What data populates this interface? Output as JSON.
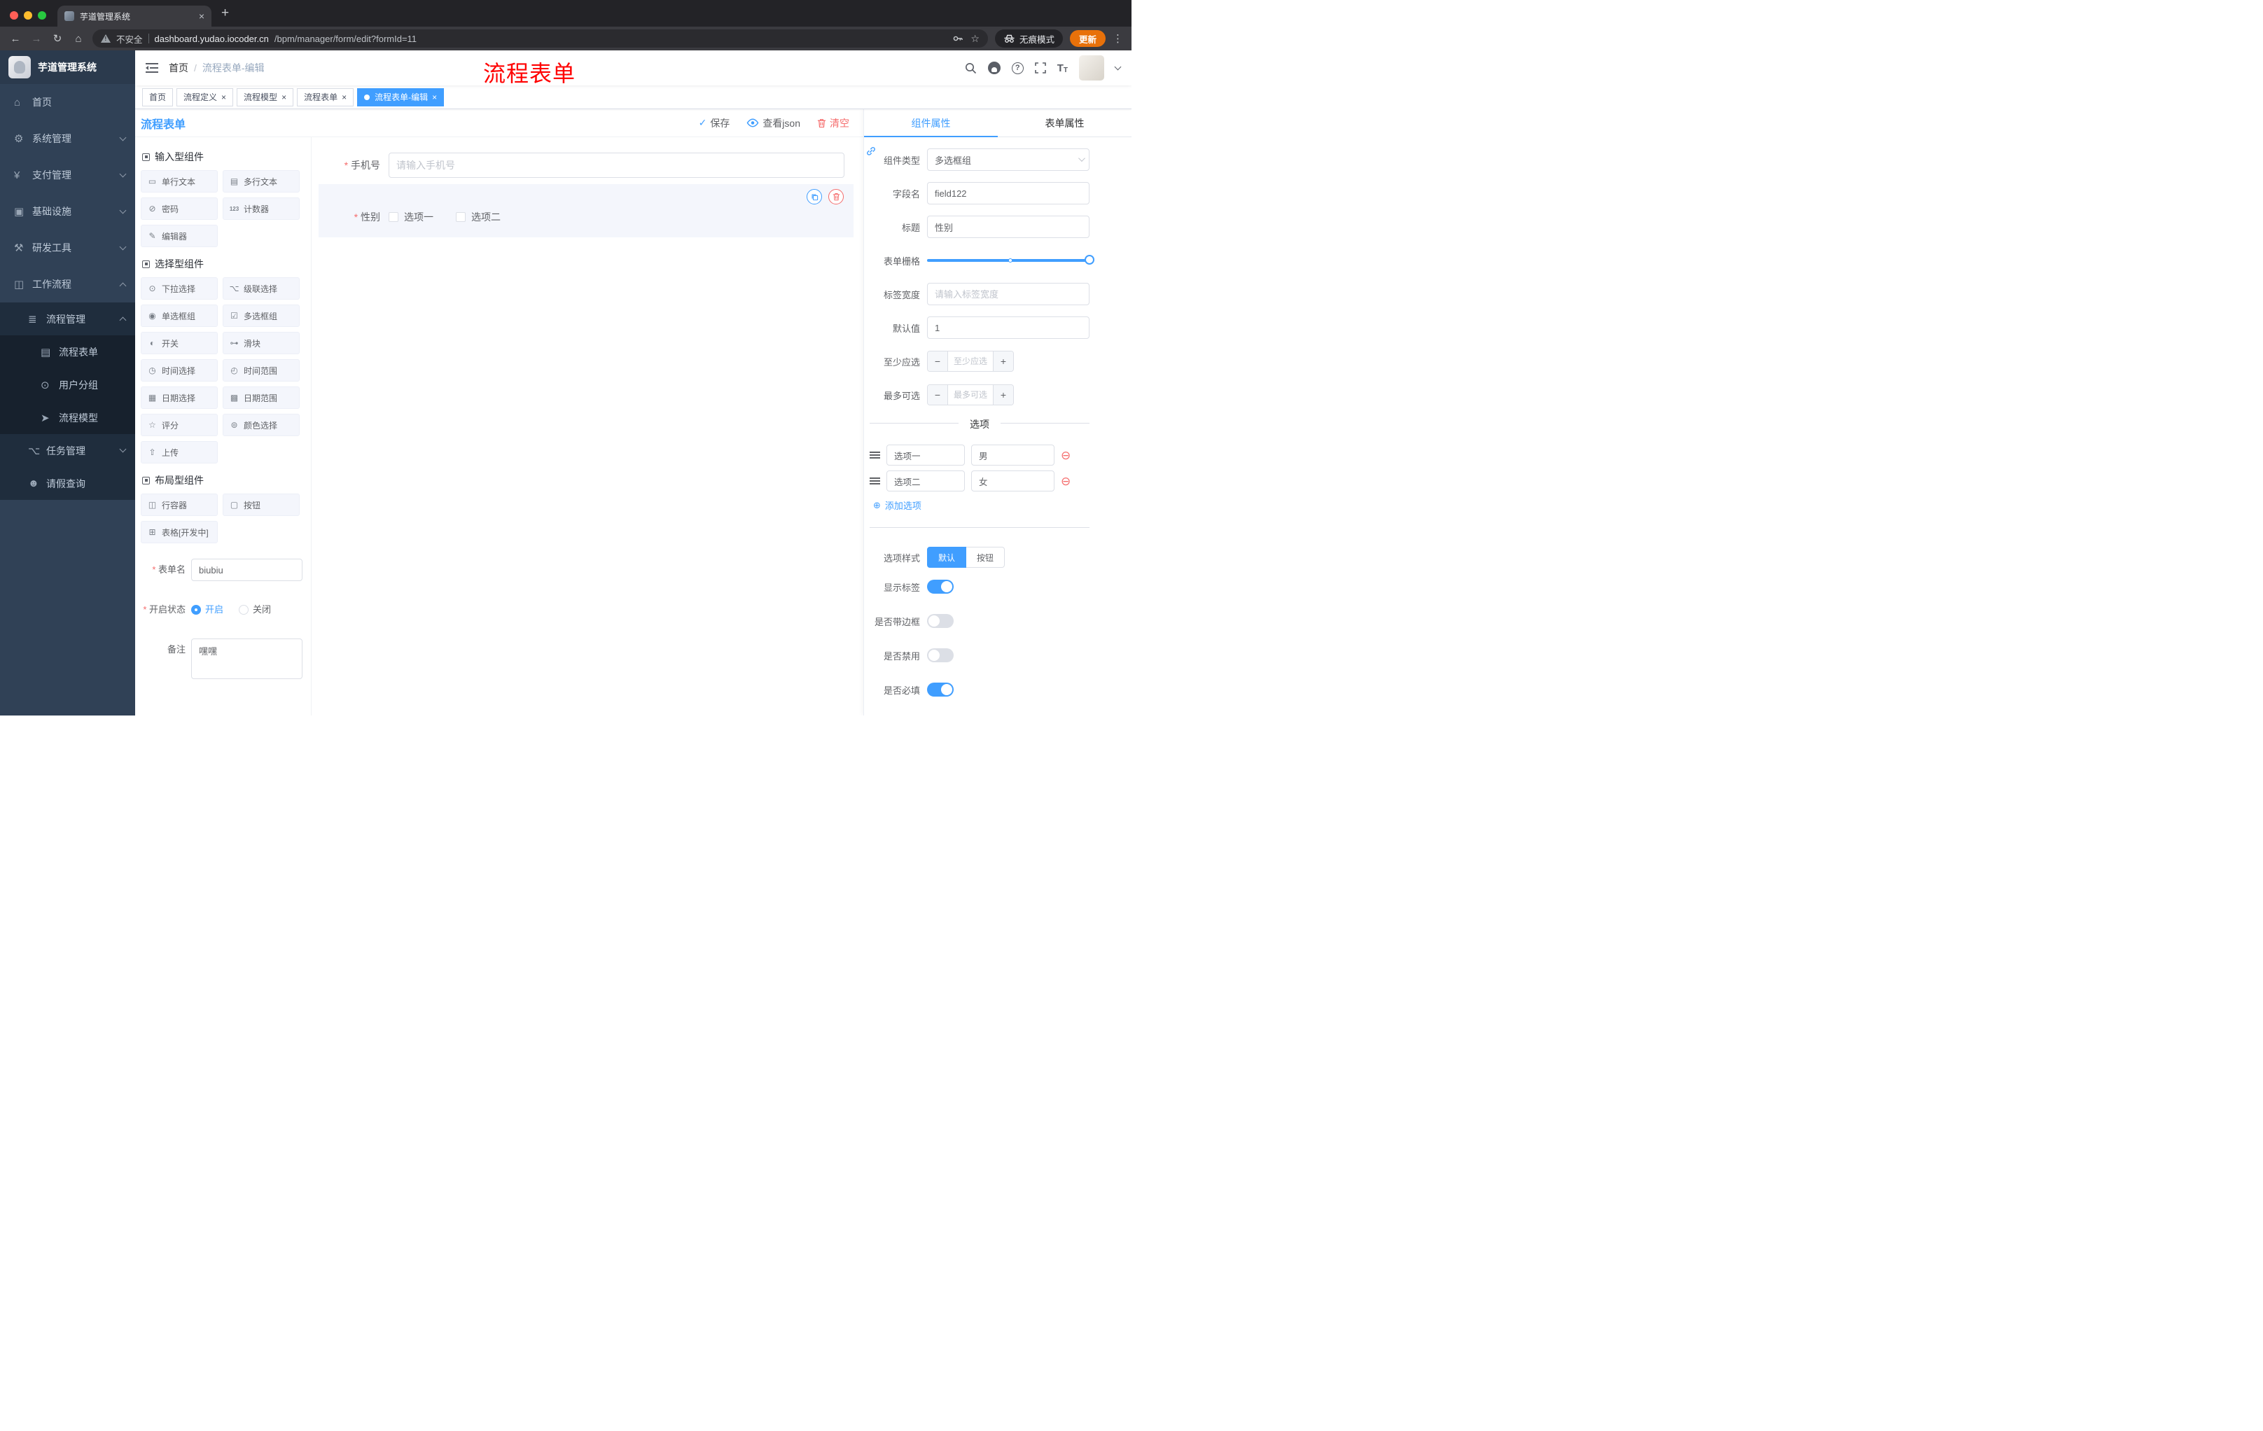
{
  "browser": {
    "tab_title": "芋道管理系统",
    "security_label": "不安全",
    "url_domain": "dashboard.yudao.iocoder.cn",
    "url_path": "/bpm/manager/form/edit?formId=11",
    "incognito_label": "无痕模式",
    "update_label": "更新"
  },
  "icons": {
    "back": "←",
    "forward": "→",
    "reload": "↻",
    "home": "⌂",
    "bookmark_star": "☆",
    "menu_dots": "⋮",
    "new_tab": "+",
    "close": "×",
    "check": "✓",
    "plus": "+",
    "minus": "−",
    "add_circle": "⊕",
    "remove_circle": "⊖"
  },
  "sidebar": {
    "app_title": "芋道管理系统",
    "menu": [
      {
        "label": "首页",
        "glyph": "⌂"
      },
      {
        "label": "系统管理",
        "glyph": "⚙"
      },
      {
        "label": "支付管理",
        "glyph": "¥"
      },
      {
        "label": "基础设施",
        "glyph": "▣"
      },
      {
        "label": "研发工具",
        "glyph": "⚒"
      },
      {
        "label": "工作流程",
        "glyph": "◫"
      },
      {
        "label": "流程管理",
        "glyph": "≣"
      },
      {
        "label": "流程表单",
        "glyph": "▤"
      },
      {
        "label": "用户分组",
        "glyph": "⊙"
      },
      {
        "label": "流程模型",
        "glyph": "➤"
      },
      {
        "label": "任务管理",
        "glyph": "⌥"
      },
      {
        "label": "请假查询",
        "glyph": "☻"
      }
    ]
  },
  "navbar": {
    "breadcrumb_home": "首页",
    "breadcrumb_separator": "/",
    "breadcrumb_current": "流程表单-编辑",
    "annotation": "流程表单"
  },
  "tags": [
    {
      "label": "首页"
    },
    {
      "label": "流程定义"
    },
    {
      "label": "流程模型"
    },
    {
      "label": "流程表单"
    },
    {
      "label": "流程表单-编辑"
    }
  ],
  "editor": {
    "title": "流程表单",
    "actions": {
      "save": "保存",
      "view_json": "查看json",
      "clear": "清空"
    },
    "groups": [
      {
        "title": "输入型组件",
        "items": [
          {
            "label": "单行文本",
            "glyph": "▭"
          },
          {
            "label": "多行文本",
            "glyph": "▤"
          },
          {
            "label": "密码",
            "glyph": "⊘"
          },
          {
            "label": "计数器",
            "glyph": "123"
          },
          {
            "label": "编辑器",
            "glyph": "✎"
          }
        ]
      },
      {
        "title": "选择型组件",
        "items": [
          {
            "label": "下拉选择",
            "glyph": "⊙"
          },
          {
            "label": "级联选择",
            "glyph": "⌥"
          },
          {
            "label": "单选框组",
            "glyph": "◉"
          },
          {
            "label": "多选框组",
            "glyph": "☑"
          },
          {
            "label": "开关",
            "glyph": "◐"
          },
          {
            "label": "滑块",
            "glyph": "⊶"
          },
          {
            "label": "时间选择",
            "glyph": "◷"
          },
          {
            "label": "时间范围",
            "glyph": "◴"
          },
          {
            "label": "日期选择",
            "glyph": "▦"
          },
          {
            "label": "日期范围",
            "glyph": "▩"
          },
          {
            "label": "评分",
            "glyph": "☆"
          },
          {
            "label": "颜色选择",
            "glyph": "⊚"
          },
          {
            "label": "上传",
            "glyph": "⇧"
          }
        ]
      },
      {
        "title": "布局型组件",
        "items": [
          {
            "label": "行容器",
            "glyph": "◫"
          },
          {
            "label": "按钮",
            "glyph": "▢"
          },
          {
            "label": "表格[开发中]",
            "glyph": "⊞"
          }
        ]
      }
    ],
    "meta": {
      "form_name_label": "表单名",
      "form_name_value": "biubiu",
      "status_label": "开启状态",
      "status_on": "开启",
      "status_off": "关闭",
      "remark_label": "备注",
      "remark_value": "嘿嘿"
    },
    "canvas": {
      "phone_label": "手机号",
      "phone_placeholder": "请输入手机号",
      "gender_label": "性别",
      "gender_option1": "选项一",
      "gender_option2": "选项二"
    }
  },
  "props": {
    "tab_component": "组件属性",
    "tab_form": "表单属性",
    "component_type_label": "组件类型",
    "component_type_value": "多选框组",
    "field_name_label": "字段名",
    "field_name_value": "field122",
    "title_label": "标题",
    "title_value": "性别",
    "grid_label": "表单栅格",
    "label_width_label": "标签宽度",
    "label_width_placeholder": "请输入标签宽度",
    "default_label": "默认值",
    "default_value": "1",
    "min_label": "至少应选",
    "min_placeholder": "至少应选",
    "max_label": "最多可选",
    "max_placeholder": "最多可选",
    "options_title": "选项",
    "options": [
      {
        "label": "选项一",
        "value": "男"
      },
      {
        "label": "选项二",
        "value": "女"
      }
    ],
    "add_option_label": "添加选项",
    "style_label": "选项样式",
    "style_default": "默认",
    "style_button": "按钮",
    "switch_show_label": "显示标签",
    "switch_border": "是否带边框",
    "switch_disabled": "是否禁用",
    "switch_required": "是否必填"
  },
  "colors": {
    "primary": "#409eff",
    "danger": "#f56c6c",
    "annotation": "#ff0000",
    "update": "#e8710a"
  }
}
